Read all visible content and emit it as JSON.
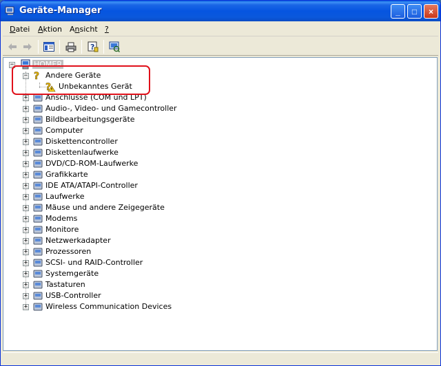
{
  "window": {
    "title": "Geräte-Manager",
    "controls": [
      "_",
      "□",
      "×"
    ]
  },
  "menu": {
    "items": [
      {
        "label": "Datei",
        "accel": "D",
        "rest": "atei"
      },
      {
        "label": "Aktion",
        "accel": "A",
        "rest": "ktion"
      },
      {
        "label": "Ansicht",
        "accel": "n",
        "pre": "A",
        "rest": "sicht"
      },
      {
        "label": "?",
        "accel": "?",
        "rest": ""
      }
    ]
  },
  "toolbar": {
    "buttons": [
      "back-icon",
      "forward-icon",
      "properties-icon",
      "print-icon",
      "help-icon",
      "scan-hardware-icon"
    ]
  },
  "tree": {
    "root": "HOMER",
    "other_devices": {
      "label": "Andere Geräte",
      "children": [
        "Unbekanntes Gerät"
      ]
    },
    "categories": [
      {
        "label": "Anschlüsse (COM und LPT)",
        "icon": "port-icon"
      },
      {
        "label": "Audio-, Video- und Gamecontroller",
        "icon": "speaker-icon"
      },
      {
        "label": "Bildbearbeitungsgeräte",
        "icon": "camera-icon"
      },
      {
        "label": "Computer",
        "icon": "computer-icon"
      },
      {
        "label": "Diskettencontroller",
        "icon": "floppy-controller-icon"
      },
      {
        "label": "Diskettenlaufwerke",
        "icon": "floppy-drive-icon"
      },
      {
        "label": "DVD/CD-ROM-Laufwerke",
        "icon": "cdrom-icon"
      },
      {
        "label": "Grafikkarte",
        "icon": "display-adapter-icon"
      },
      {
        "label": "IDE ATA/ATAPI-Controller",
        "icon": "ide-controller-icon"
      },
      {
        "label": "Laufwerke",
        "icon": "disk-drive-icon"
      },
      {
        "label": "Mäuse und andere Zeigegeräte",
        "icon": "mouse-icon"
      },
      {
        "label": "Modems",
        "icon": "modem-icon"
      },
      {
        "label": "Monitore",
        "icon": "monitor-icon"
      },
      {
        "label": "Netzwerkadapter",
        "icon": "network-adapter-icon"
      },
      {
        "label": "Prozessoren",
        "icon": "processor-icon"
      },
      {
        "label": "SCSI- und RAID-Controller",
        "icon": "scsi-icon"
      },
      {
        "label": "Systemgeräte",
        "icon": "system-device-icon"
      },
      {
        "label": "Tastaturen",
        "icon": "keyboard-icon"
      },
      {
        "label": "USB-Controller",
        "icon": "usb-icon"
      },
      {
        "label": "Wireless Communication Devices",
        "icon": "wireless-icon"
      }
    ]
  },
  "colors": {
    "titlebar": "#0655e0",
    "highlight": "#e0101a",
    "window_bg": "#ece9d8"
  }
}
